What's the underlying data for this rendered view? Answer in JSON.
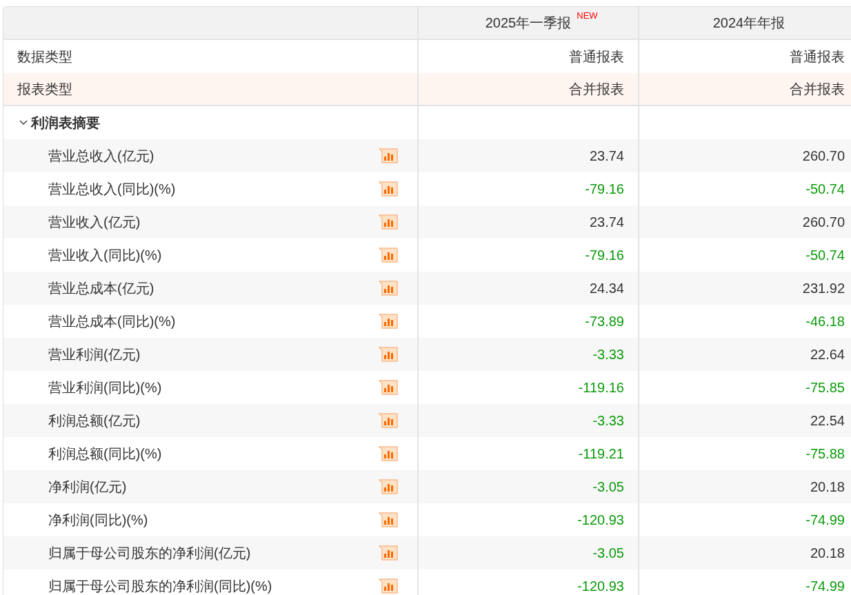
{
  "columns": [
    {
      "label": "2025年一季报",
      "badge": "NEW"
    },
    {
      "label": "2024年年报"
    }
  ],
  "meta_rows": [
    {
      "label": "数据类型",
      "values": [
        "普通报表",
        "普通报表"
      ],
      "highlighted": false
    },
    {
      "label": "报表类型",
      "values": [
        "合并报表",
        "合并报表"
      ],
      "highlighted": true
    }
  ],
  "section": {
    "title": "利润表摘要",
    "expanded": true,
    "rows": [
      {
        "label": "营业总收入(亿元)",
        "values": [
          {
            "text": "23.74",
            "negative": false
          },
          {
            "text": "260.70",
            "negative": false
          }
        ]
      },
      {
        "label": "营业总收入(同比)(%)",
        "values": [
          {
            "text": "-79.16",
            "negative": true
          },
          {
            "text": "-50.74",
            "negative": true
          }
        ]
      },
      {
        "label": "营业收入(亿元)",
        "values": [
          {
            "text": "23.74",
            "negative": false
          },
          {
            "text": "260.70",
            "negative": false
          }
        ]
      },
      {
        "label": "营业收入(同比)(%)",
        "values": [
          {
            "text": "-79.16",
            "negative": true
          },
          {
            "text": "-50.74",
            "negative": true
          }
        ]
      },
      {
        "label": "营业总成本(亿元)",
        "values": [
          {
            "text": "24.34",
            "negative": false
          },
          {
            "text": "231.92",
            "negative": false
          }
        ]
      },
      {
        "label": "营业总成本(同比)(%)",
        "values": [
          {
            "text": "-73.89",
            "negative": true
          },
          {
            "text": "-46.18",
            "negative": true
          }
        ]
      },
      {
        "label": "营业利润(亿元)",
        "values": [
          {
            "text": "-3.33",
            "negative": true
          },
          {
            "text": "22.64",
            "negative": false
          }
        ]
      },
      {
        "label": "营业利润(同比)(%)",
        "values": [
          {
            "text": "-119.16",
            "negative": true
          },
          {
            "text": "-75.85",
            "negative": true
          }
        ]
      },
      {
        "label": "利润总额(亿元)",
        "values": [
          {
            "text": "-3.33",
            "negative": true
          },
          {
            "text": "22.54",
            "negative": false
          }
        ]
      },
      {
        "label": "利润总额(同比)(%)",
        "values": [
          {
            "text": "-119.21",
            "negative": true
          },
          {
            "text": "-75.88",
            "negative": true
          }
        ]
      },
      {
        "label": "净利润(亿元)",
        "values": [
          {
            "text": "-3.05",
            "negative": true
          },
          {
            "text": "20.18",
            "negative": false
          }
        ]
      },
      {
        "label": "净利润(同比)(%)",
        "values": [
          {
            "text": "-120.93",
            "negative": true
          },
          {
            "text": "-74.99",
            "negative": true
          }
        ]
      },
      {
        "label": "归属于母公司股东的净利润(亿元)",
        "values": [
          {
            "text": "-3.05",
            "negative": true
          },
          {
            "text": "20.18",
            "negative": false
          }
        ]
      },
      {
        "label": "归属于母公司股东的净利润(同比)(%)",
        "values": [
          {
            "text": "-120.93",
            "negative": true
          },
          {
            "text": "-74.99",
            "negative": true
          }
        ]
      }
    ]
  }
}
